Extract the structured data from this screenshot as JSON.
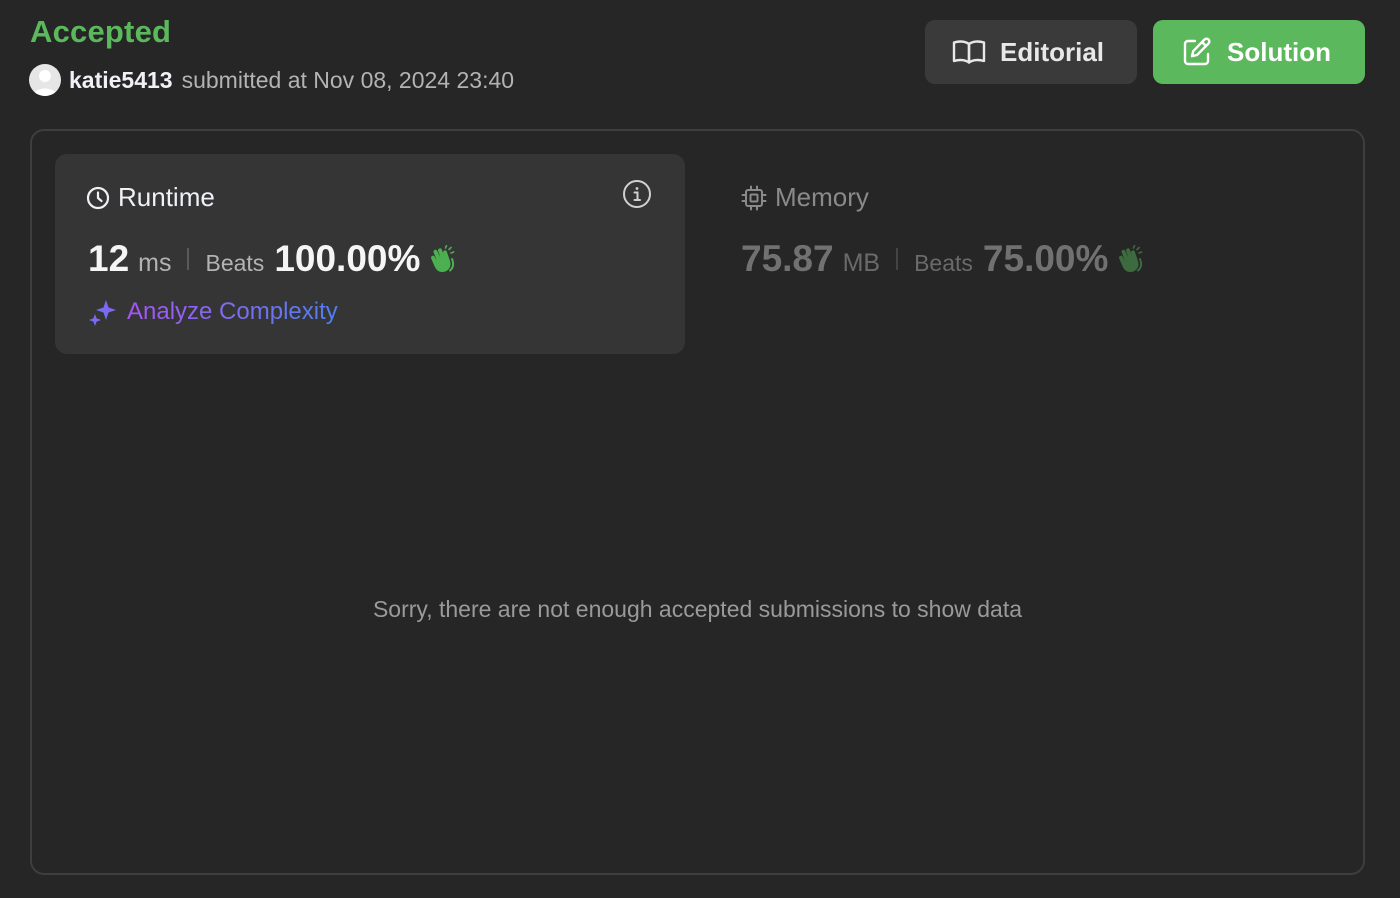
{
  "header": {
    "status": "Accepted",
    "username": "katie5413",
    "submitted_text": "submitted at Nov 08, 2024 23:40"
  },
  "buttons": {
    "editorial_label": "Editorial",
    "solution_label": "Solution"
  },
  "runtime": {
    "title": "Runtime",
    "value": "12",
    "unit": "ms",
    "beats_label": "Beats",
    "beats_value": "100.00%",
    "analyze_label": "Analyze Complexity"
  },
  "memory": {
    "title": "Memory",
    "value": "75.87",
    "unit": "MB",
    "beats_label": "Beats",
    "beats_value": "75.00%"
  },
  "empty_message": "Sorry, there are not enough accepted submissions to show data",
  "colors": {
    "background": "#262626",
    "accent_green": "#5cb85c",
    "card": "#353535"
  },
  "icons": [
    "avatar-icon",
    "book-icon",
    "edit-icon",
    "clock-icon",
    "info-icon",
    "clap-icon",
    "sparkle-icon",
    "cpu-icon"
  ]
}
